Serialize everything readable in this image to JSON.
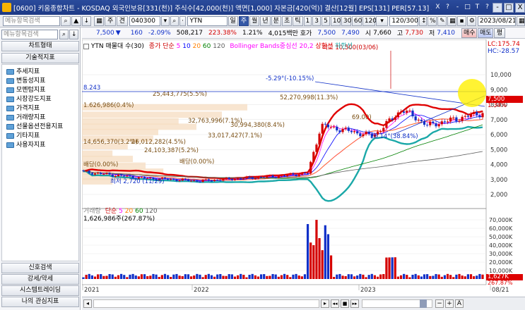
{
  "window": {
    "title": "[0600] 키움종합차트 - KOSDAQ 외국인보유[331(천)] 주식수[42,000(천)] 액면[1,000] 자본금[420(억)] 결산[12월] EPS[131] PER[57.13] 시가총액[",
    "buttons": [
      "X",
      "?",
      "-",
      "□",
      "T",
      "?",
      "-",
      "□",
      "X"
    ]
  },
  "toolbar1": {
    "search_placeholder": "메뉴항목검색",
    "search_icon": "search-icon",
    "code": "040300",
    "stock_name": "YTN",
    "period_tabs": [
      "일",
      "주",
      "월",
      "년",
      "분",
      "초",
      "틱"
    ],
    "selected_period": "주",
    "interval_buttons": [
      "1",
      "3",
      "5",
      "10",
      "30",
      "60",
      "120"
    ],
    "count": "120/300",
    "date": "2023/08/21",
    "small_labels": [
      "주",
      "견"
    ]
  },
  "quote": {
    "price": "7,500",
    "change": "160",
    "change_pct": "-2.09%",
    "volume": "508,217",
    "vol_ratio": "223.38%",
    "turnover": "1.21%",
    "amount": "4,015백만 호가",
    "ask": "7,500",
    "bid": "7,490",
    "open_label": "시",
    "open": "7,660",
    "high_label": "고",
    "high": "7,730",
    "low_label": "저",
    "low": "7,410",
    "sell_button": "매수",
    "buy_button": "매도",
    "clear_button": "평"
  },
  "sidebar": {
    "search_placeholder": "메뉴항목검색",
    "top_button": "차트형태",
    "section_button": "기술적지표",
    "tree": [
      "추세지표",
      "변동성지표",
      "모멘텀지표",
      "시장강도지표",
      "가격지표",
      "거래량지표",
      "선물옵션전용지표",
      "기타지표",
      "사용자지표"
    ],
    "bottom_buttons": [
      "신호검색",
      "강세/약세",
      "시스템트레이딩",
      "나의 관심지표"
    ]
  },
  "price_panel": {
    "legend_name": "YTN 매물대 수(30)",
    "legend_ma": "종가 단순",
    "ma_periods": [
      "5",
      "10",
      "20",
      "60",
      "120"
    ],
    "ma_colors": [
      "#ff00ff",
      "#0000ff",
      "#ff8000",
      "#008000",
      "#606060"
    ],
    "legend_bb": "Bollinger Bands중심선 20,2",
    "legend_bb_upper": "상한선",
    "legend_bb_lower": "하한선",
    "lc": "LC:175.74",
    "hc": "HC:-28.57",
    "high_annot": "최고 10,500(03/06)",
    "low_annot": "최저 2,720 (11/29)",
    "pct_annot_top": "-5.29°(-10.15%)",
    "pct_annot_mid": "28.14°(38.84%)",
    "line_value": "8.243",
    "price_tag": "7,500",
    "price_tag_pct": "1.34%",
    "vp_labels": [
      "25,443,775(5.5%)",
      "52,270,998(11.3%)",
      "32,763,996(7.1%)",
      "30,994,380(8.4%)",
      "33,017,427(7.1%)",
      "26,012,282(4.5%)",
      "24,103,387(5.2%)",
      "1.626,986(0.4%)",
      "14,656,370(3.2%)",
      "배당(0.00%)",
      "배당(0.00%)",
      "69.00)"
    ],
    "y_ticks": [
      "10,000",
      "9,000",
      "8,000",
      "7,000",
      "6,000",
      "5,000",
      "4,000",
      "3,000",
      "2,000"
    ]
  },
  "volume_panel": {
    "legend_name": "거래량",
    "legend_ma": "단순",
    "ma_periods": [
      "5",
      "20",
      "60",
      "120"
    ],
    "ma_colors": [
      "#ff00ff",
      "#ff8000",
      "#008000",
      "#606060"
    ],
    "value_annot": "1,626,986주(267.87%)",
    "y_ticks": [
      "70,000K",
      "60,000K",
      "50,000K",
      "40,000K",
      "30,000K",
      "20,000K",
      "10,000K"
    ],
    "tag_value": "1,627K",
    "tag_pct": "267.87%"
  },
  "x_axis": {
    "labels": [
      "2021",
      "2022",
      "2023",
      "08/21"
    ]
  },
  "colors": {
    "up": "#d40000",
    "down": "#1030c8",
    "bb": "#e00000",
    "bb_lower": "#1aa8a8",
    "brand": "#2a4b9c"
  }
}
